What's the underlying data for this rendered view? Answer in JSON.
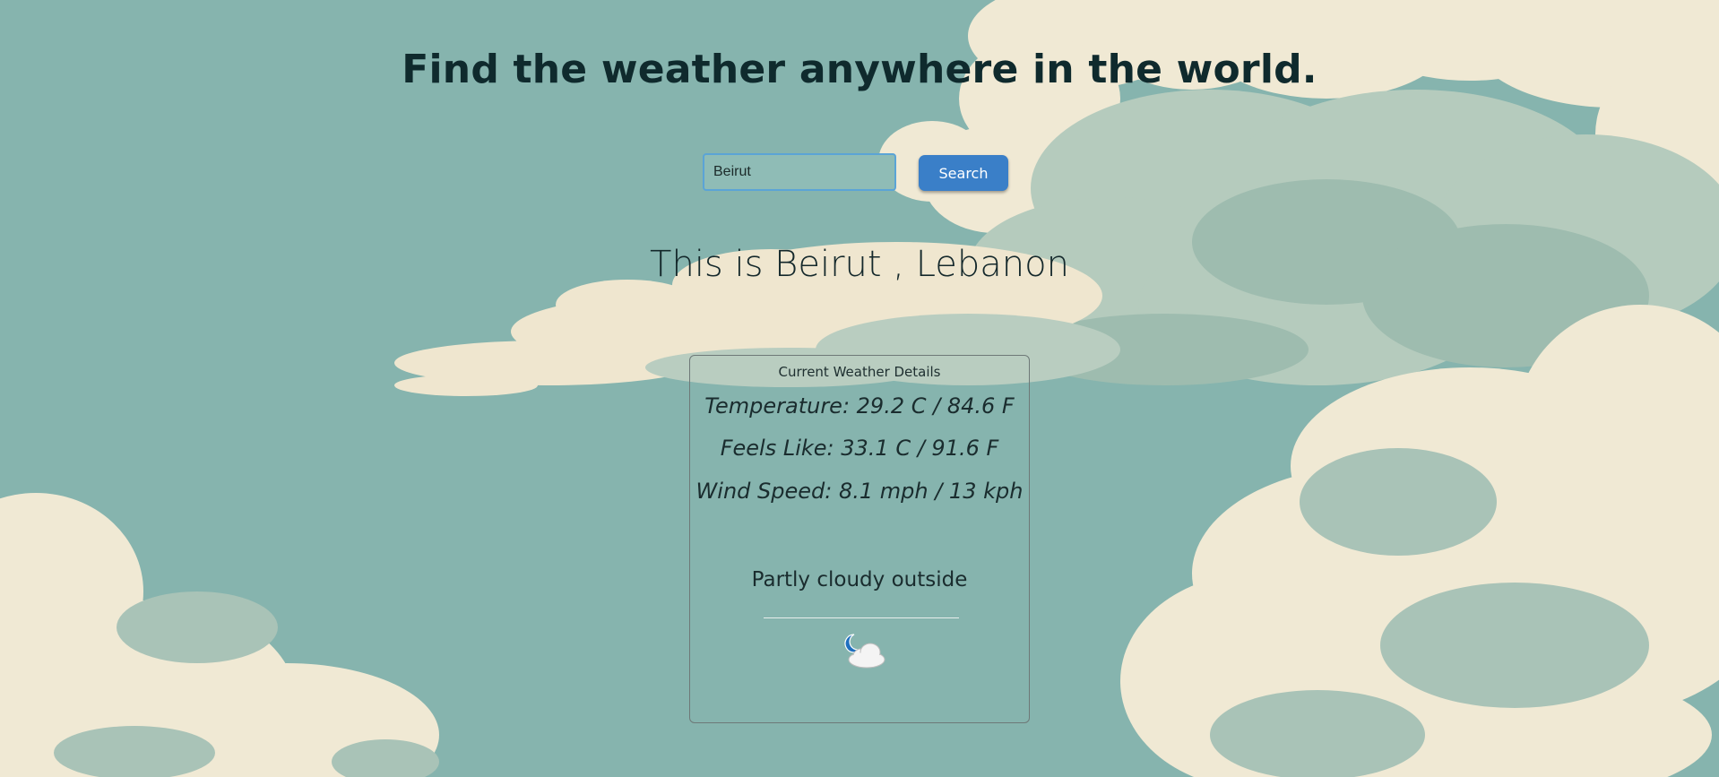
{
  "header": {
    "title": "Find the weather anywhere in the world."
  },
  "search": {
    "value": "Beirut",
    "placeholder": "",
    "button_label": "Search"
  },
  "location": {
    "heading": "This is Beirut , Lebanon"
  },
  "card": {
    "heading": "Current Weather Details",
    "temperature": "Temperature: 29.2 C / 84.6 F",
    "feels_like": "Feels Like: 33.1 C / 91.6 F",
    "wind_speed": "Wind Speed: 8.1 mph / 13 kph",
    "condition": "Partly cloudy outside",
    "icon": "partly-cloudy-night-icon"
  },
  "colors": {
    "sky": "#86b4ae",
    "cloud_cream": "#f2ebd6",
    "cloud_sage": "#b8cdbf",
    "title_text": "#0f2a2d",
    "button": "#3a7fc8",
    "input_border": "#5ba4d6"
  }
}
